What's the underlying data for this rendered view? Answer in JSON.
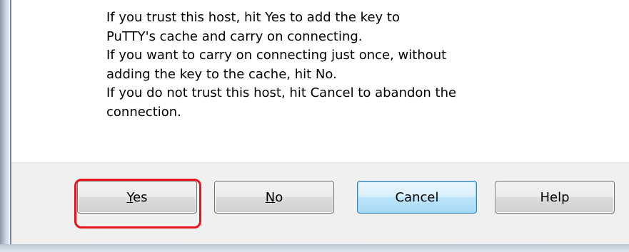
{
  "dialog": {
    "message_lines": [
      "If you trust this host, hit Yes to add the key to",
      "PuTTY's cache and carry on connecting.",
      "If you want to carry on connecting just once, without",
      "adding the key to the cache, hit No.",
      "If you do not trust this host, hit Cancel to abandon the",
      "connection."
    ],
    "buttons": {
      "yes": "Yes",
      "no": "No",
      "cancel": "Cancel",
      "help": "Help"
    },
    "default_button": "cancel",
    "highlighted_button": "yes",
    "highlight_color": "#e8141d"
  }
}
